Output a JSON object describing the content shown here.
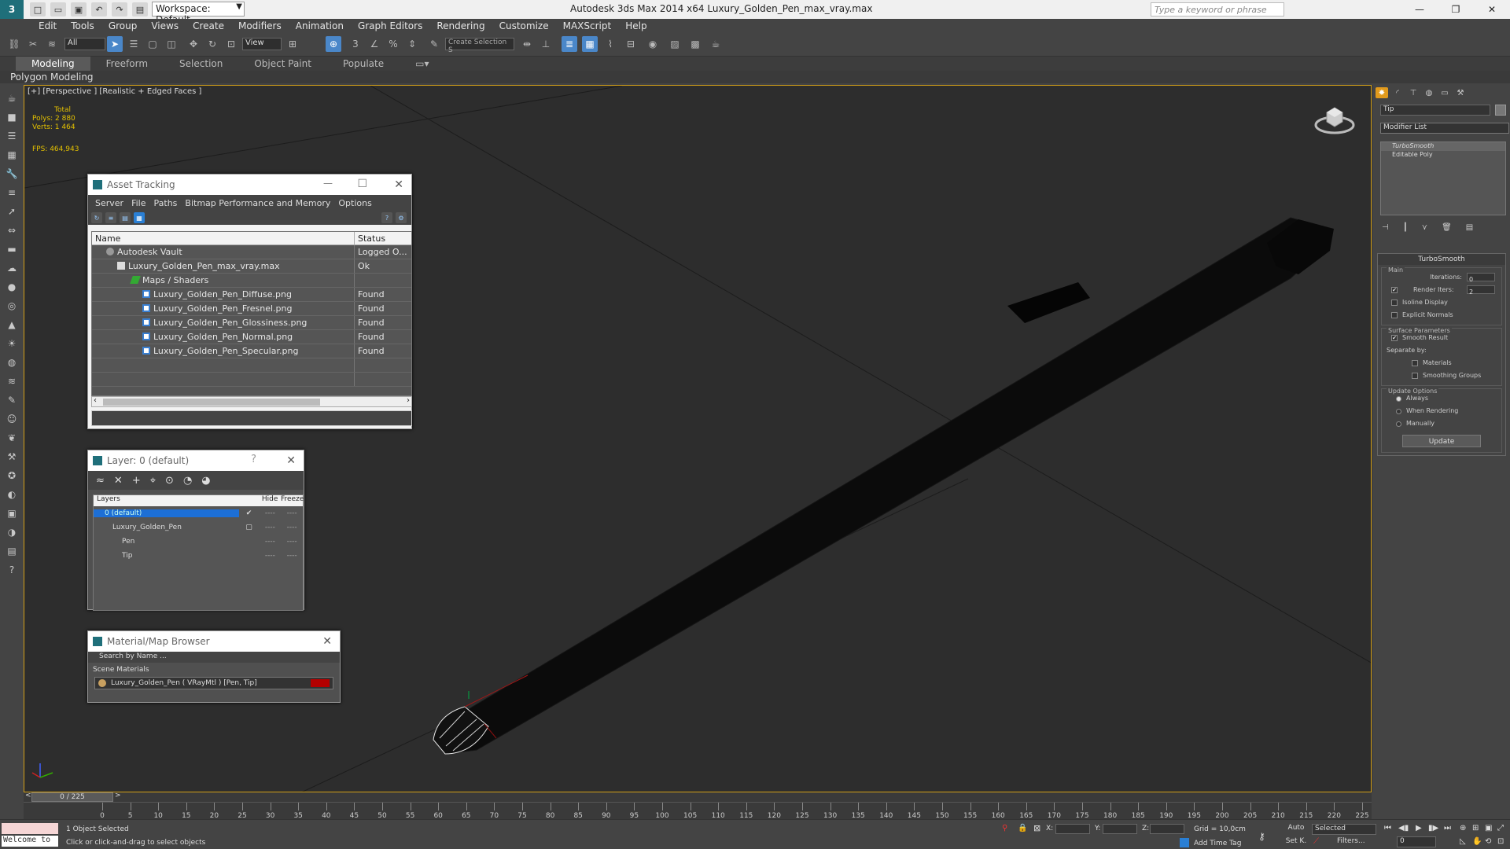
{
  "app": {
    "title": "Autodesk 3ds Max  2014 x64     Luxury_Golden_Pen_max_vray.max",
    "workspace": "Workspace: Default",
    "search_placeholder": "Type a keyword or phrase"
  },
  "menu": [
    "Edit",
    "Tools",
    "Group",
    "Views",
    "Create",
    "Modifiers",
    "Animation",
    "Graph Editors",
    "Rendering",
    "Customize",
    "MAXScript",
    "Help"
  ],
  "toolbar": {
    "selection_filter": "All",
    "reference_coord": "View",
    "named_selection": "Create Selection S"
  },
  "ribbon": {
    "tabs": [
      "Modeling",
      "Freeform",
      "Selection",
      "Object Paint",
      "Populate"
    ],
    "active_tab": "Modeling",
    "sub_label": "Polygon Modeling"
  },
  "viewport": {
    "label": "[+] [Perspective ] [Realistic + Edged Faces ]",
    "stats_total": "Total",
    "polys": "Polys:   2 880",
    "verts": "Verts:   1 464",
    "fps": "FPS:     464,943"
  },
  "asset_tracking": {
    "title": "Asset Tracking",
    "menu": [
      "Server",
      "File",
      "Paths",
      "Bitmap Performance and Memory",
      "Options"
    ],
    "columns": [
      "Name",
      "Status"
    ],
    "rows": [
      {
        "name": "Autodesk Vault",
        "status": "Logged O..."
      },
      {
        "name": "Luxury_Golden_Pen_max_vray.max",
        "status": "Ok"
      },
      {
        "name": "Maps / Shaders",
        "status": ""
      },
      {
        "name": "Luxury_Golden_Pen_Diffuse.png",
        "status": "Found"
      },
      {
        "name": "Luxury_Golden_Pen_Fresnel.png",
        "status": "Found"
      },
      {
        "name": "Luxury_Golden_Pen_Glossiness.png",
        "status": "Found"
      },
      {
        "name": "Luxury_Golden_Pen_Normal.png",
        "status": "Found"
      },
      {
        "name": "Luxury_Golden_Pen_Specular.png",
        "status": "Found"
      }
    ]
  },
  "layer_manager": {
    "title": "Layer: 0 (default)",
    "columns": [
      "Layers",
      "Hide",
      "Freeze"
    ],
    "rows": [
      {
        "name": "0 (default)",
        "dash": "----"
      },
      {
        "name": "Luxury_Golden_Pen",
        "dash": "----"
      },
      {
        "name": "Pen",
        "dash": "----"
      },
      {
        "name": "Tip",
        "dash": "----"
      }
    ]
  },
  "material_browser": {
    "title": "Material/Map Browser",
    "search_placeholder": "Search by Name ...",
    "section": "Scene Materials",
    "item": "Luxury_Golden_Pen  ( VRayMtl )  [Pen, Tip]"
  },
  "command_panel": {
    "object_name": "Tip",
    "modifier_list": "Modifier List",
    "stack": [
      "TurboSmooth",
      "Editable Poly"
    ],
    "rollout_title": "TurboSmooth",
    "main_group": "Main",
    "iterations_label": "Iterations:",
    "iterations_value": "0",
    "render_iters_label": "Render Iters:",
    "render_iters_value": "2",
    "isoline": "Isoline Display",
    "explicit_normals": "Explicit Normals",
    "surface_group": "Surface Parameters",
    "smooth_result": "Smooth Result",
    "separate_by": "Separate by:",
    "materials": "Materials",
    "smoothing_groups": "Smoothing Groups",
    "update_group": "Update Options",
    "always": "Always",
    "when_rendering": "When Rendering",
    "manually": "Manually",
    "update_button": "Update"
  },
  "timeline": {
    "slider": "0 / 225",
    "ticks": [
      "0",
      "5",
      "10",
      "15",
      "20",
      "25",
      "30",
      "35",
      "40",
      "45",
      "50",
      "55",
      "60",
      "65",
      "70",
      "75",
      "80",
      "85",
      "90",
      "95",
      "100",
      "105",
      "110",
      "115",
      "120",
      "125",
      "130",
      "135",
      "140",
      "145",
      "150",
      "155",
      "160",
      "165",
      "170",
      "175",
      "180",
      "185",
      "190",
      "195",
      "200",
      "205",
      "210",
      "215",
      "220",
      "225"
    ]
  },
  "status": {
    "maxscript": "",
    "maxscript_listener": "Welcome to",
    "selected": "1 Object Selected",
    "prompt": "Click or click-and-drag to select objects",
    "x_label": "X:",
    "y_label": "Y:",
    "z_label": "Z:",
    "grid": "Grid = 10,0cm",
    "add_time_tag": "Add Time Tag",
    "auto": "Auto",
    "set_key": "Set K.",
    "selected_dd": "Selected",
    "filters": "Filters...",
    "frame": "0"
  }
}
